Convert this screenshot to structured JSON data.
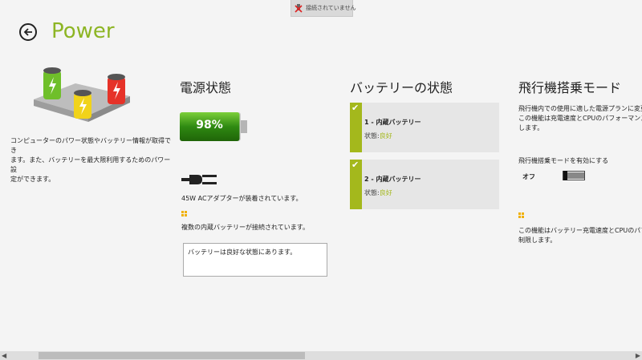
{
  "toast": {
    "text": "接続されていません"
  },
  "header": {
    "title": "Power"
  },
  "left": {
    "description_line1": "コンピューターのパワー状態やバッテリー情報が取得でき",
    "description_line2": "ます。また、バッテリーを最大限利用するためのパワー設",
    "description_line3": "定ができます。"
  },
  "power_state": {
    "heading": "電源状態",
    "battery_percent": "98%",
    "battery_level": 0.98,
    "adapter_text": "45W ACアダプターが装着されています。",
    "multi_battery_text": "複数の内蔵バッテリーが接続されています。",
    "message": "バッテリーは良好な状態にあります。"
  },
  "battery_status": {
    "heading": "バッテリーの状態",
    "cards": [
      {
        "title": "1 - 内蔵バッテリー",
        "status_label": "状態:",
        "status_value": "良好"
      },
      {
        "title": "2 - 内蔵バッテリー",
        "status_label": "状態:",
        "status_value": "良好"
      }
    ]
  },
  "airplane": {
    "heading": "飛行機搭乗モード",
    "desc_line1": "飛行機内での使用に適した電源プランに変更",
    "desc_line2": "この機能は充電速度とCPUのパフォーマンスを",
    "desc_line3": "します。",
    "toggle_label": "飛行機搭乗モードを有効にする",
    "toggle_state": "オフ",
    "note_line1": "この機能はバッテリー充電速度とCPUのパフォ",
    "note_line2": "制限します。"
  },
  "colors": {
    "accent": "#8db524",
    "card_bar": "#a4b81c",
    "battery_green": "#3a8a1a"
  }
}
